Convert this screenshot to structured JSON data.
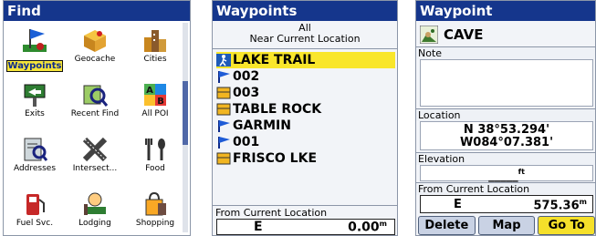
{
  "find": {
    "title": "Find",
    "items": [
      {
        "label": "Waypoints",
        "icon": "waypoints-flag-icon",
        "selected": true
      },
      {
        "label": "Geocache",
        "icon": "geocache-box-icon",
        "selected": false
      },
      {
        "label": "Cities",
        "icon": "city-buildings-icon",
        "selected": false
      },
      {
        "label": "Exits",
        "icon": "exit-sign-icon",
        "selected": false
      },
      {
        "label": "Recent Find",
        "icon": "recent-find-icon",
        "selected": false
      },
      {
        "label": "All POI",
        "icon": "all-poi-icon",
        "selected": false
      },
      {
        "label": "Addresses",
        "icon": "address-book-icon",
        "selected": false
      },
      {
        "label": "Intersect...",
        "icon": "intersection-icon",
        "selected": false
      },
      {
        "label": "Food",
        "icon": "food-utensils-icon",
        "selected": false
      },
      {
        "label": "Fuel Svc.",
        "icon": "fuel-pump-icon",
        "selected": false
      },
      {
        "label": "Lodging",
        "icon": "lodging-bed-icon",
        "selected": false
      },
      {
        "label": "Shopping",
        "icon": "shopping-bag-icon",
        "selected": false
      }
    ]
  },
  "waypoints": {
    "title": "Waypoints",
    "filter": "All",
    "near": "Near Current Location",
    "list": [
      {
        "name": "LAKE TRAIL",
        "icon": "hiker-icon",
        "selected": true
      },
      {
        "name": "002",
        "icon": "blue-flag-icon",
        "selected": false
      },
      {
        "name": "003",
        "icon": "cache-box-icon",
        "selected": false
      },
      {
        "name": "TABLE ROCK",
        "icon": "cache-box-icon",
        "selected": false
      },
      {
        "name": "GARMIN",
        "icon": "blue-flag-icon",
        "selected": false
      },
      {
        "name": "001",
        "icon": "blue-flag-icon",
        "selected": false
      },
      {
        "name": "FRISCO LKE",
        "icon": "cache-box-icon",
        "selected": false
      }
    ],
    "from_label": "From Current Location",
    "direction": "E",
    "distance": "0.00",
    "distance_unit": "m"
  },
  "detail": {
    "title": "Waypoint",
    "name": "CAVE",
    "note_label": "Note",
    "location_label": "Location",
    "lat": "N  38°53.294'",
    "lon": "W084°07.381'",
    "elevation_label": "Elevation",
    "elevation_value": "_____",
    "elevation_unit": "ft",
    "from_label": "From Current Location",
    "direction": "E",
    "distance": "575.36",
    "distance_unit": "m",
    "buttons": {
      "delete": "Delete",
      "map": "Map",
      "goto": "Go To"
    }
  },
  "colors": {
    "title_bar": "#15368c",
    "highlight": "#f9e62b",
    "button": "#c9d2e4"
  }
}
